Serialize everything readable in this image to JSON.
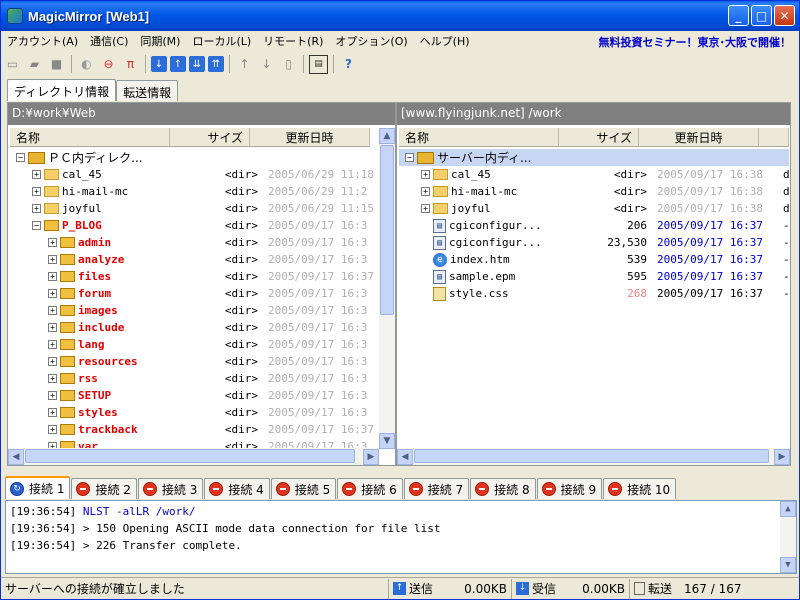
{
  "window": {
    "title": "MagicMirror [Web1]"
  },
  "menu": {
    "items": [
      "アカウント(A)",
      "通信(C)",
      "同期(M)",
      "ローカル(L)",
      "リモート(R)",
      "オプション(O)",
      "ヘルプ(H)"
    ],
    "promo": "無料投資セミナー！東京･大阪で開催！"
  },
  "toolbar": {
    "icons": [
      "new-icon",
      "open-icon",
      "save-icon",
      "connect-icon",
      "disconnect-icon",
      "filter-icon",
      "upload-icon",
      "upload-all-icon",
      "download-icon",
      "download-all-icon",
      "up-folder-icon",
      "down-folder-icon",
      "file-icon",
      "terminal-icon",
      "help-icon"
    ]
  },
  "tabs_top": [
    "ディレクトリ情報",
    "転送情報"
  ],
  "local": {
    "path": "D:¥work¥Web",
    "columns": [
      "名称",
      "サイズ",
      "更新日時"
    ],
    "rows": [
      {
        "name": "ＰＣ内ディレク...",
        "size": "",
        "date": "",
        "level": 0,
        "type": "root"
      },
      {
        "name": "cal_45",
        "size": "<dir>",
        "date": "2005/06/29 11:18",
        "level": 1,
        "type": "folder"
      },
      {
        "name": "hi-mail-mc",
        "size": "<dir>",
        "date": "2005/06/29 11:2",
        "level": 1,
        "type": "folder"
      },
      {
        "name": "joyful",
        "size": "<dir>",
        "date": "2005/06/29 11:15",
        "level": 1,
        "type": "folder"
      },
      {
        "name": "P_BLOG",
        "size": "<dir>",
        "date": "2005/09/17 16:3",
        "level": 1,
        "type": "folder-red"
      },
      {
        "name": "admin",
        "size": "<dir>",
        "date": "2005/09/17 16:3",
        "level": 2,
        "type": "folder-red"
      },
      {
        "name": "analyze",
        "size": "<dir>",
        "date": "2005/09/17 16:3",
        "level": 2,
        "type": "folder-red"
      },
      {
        "name": "files",
        "size": "<dir>",
        "date": "2005/09/17 16:37",
        "level": 2,
        "type": "folder-red"
      },
      {
        "name": "forum",
        "size": "<dir>",
        "date": "2005/09/17 16:3",
        "level": 2,
        "type": "folder-red"
      },
      {
        "name": "images",
        "size": "<dir>",
        "date": "2005/09/17 16:3",
        "level": 2,
        "type": "folder-red"
      },
      {
        "name": "include",
        "size": "<dir>",
        "date": "2005/09/17 16:3",
        "level": 2,
        "type": "folder-red"
      },
      {
        "name": "lang",
        "size": "<dir>",
        "date": "2005/09/17 16:3",
        "level": 2,
        "type": "folder-red"
      },
      {
        "name": "resources",
        "size": "<dir>",
        "date": "2005/09/17 16:3",
        "level": 2,
        "type": "folder-red"
      },
      {
        "name": "rss",
        "size": "<dir>",
        "date": "2005/09/17 16:3",
        "level": 2,
        "type": "folder-red"
      },
      {
        "name": "SETUP",
        "size": "<dir>",
        "date": "2005/09/17 16:3",
        "level": 2,
        "type": "folder-red"
      },
      {
        "name": "styles",
        "size": "<dir>",
        "date": "2005/09/17 16:3",
        "level": 2,
        "type": "folder-red"
      },
      {
        "name": "trackback",
        "size": "<dir>",
        "date": "2005/09/17 16:37",
        "level": 2,
        "type": "folder-red"
      },
      {
        "name": "var",
        "size": "<dir>",
        "date": "2005/09/17 16:3",
        "level": 2,
        "type": "folder-red"
      }
    ]
  },
  "remote": {
    "path": "[www.flyingjunk.net] /work",
    "columns": [
      "名称",
      "サイズ",
      "更新日時"
    ],
    "rows": [
      {
        "name": "サーバー内ディ...",
        "size": "",
        "date": "",
        "attr": "",
        "level": 0,
        "type": "root"
      },
      {
        "name": "cal_45",
        "size": "<dir>",
        "date": "2005/09/17 16:38",
        "attr": "d",
        "level": 1,
        "type": "folder",
        "date_color": "gray"
      },
      {
        "name": "hi-mail-mc",
        "size": "<dir>",
        "date": "2005/09/17 16:38",
        "attr": "d",
        "level": 1,
        "type": "folder",
        "date_color": "gray"
      },
      {
        "name": "joyful",
        "size": "<dir>",
        "date": "2005/09/17 16:38",
        "attr": "d",
        "level": 1,
        "type": "folder",
        "date_color": "gray"
      },
      {
        "name": "cgiconfigur...",
        "size": "206",
        "date": "2005/09/17 16:37",
        "attr": "-",
        "level": 1,
        "type": "file",
        "date_color": "blue"
      },
      {
        "name": "cgiconfigur...",
        "size": "23,530",
        "date": "2005/09/17 16:37",
        "attr": "-",
        "level": 1,
        "type": "file",
        "date_color": "blue"
      },
      {
        "name": "index.htm",
        "size": "539",
        "date": "2005/09/17 16:37",
        "attr": "-",
        "level": 1,
        "type": "ie",
        "date_color": "blue"
      },
      {
        "name": "sample.epm",
        "size": "595",
        "date": "2005/09/17 16:37",
        "attr": "-",
        "level": 1,
        "type": "file",
        "date_color": "blue"
      },
      {
        "name": "style.css",
        "size": "268",
        "date": "2005/09/17 16:37",
        "attr": "-",
        "level": 1,
        "type": "css",
        "date_color": "black",
        "size_color": "red"
      }
    ]
  },
  "connections": [
    "接続 1",
    "接続 2",
    "接続 3",
    "接続 4",
    "接続 5",
    "接続 6",
    "接続 7",
    "接続 8",
    "接続 9",
    "接続 10"
  ],
  "log": [
    {
      "time": "[19:36:54]",
      "text": "NLST -alLR /work/",
      "cmd": true
    },
    {
      "time": "[19:36:54]",
      "text": ">  150 Opening ASCII mode data connection for file list",
      "cmd": false
    },
    {
      "time": "[19:36:54]",
      "text": ">  226 Transfer complete.",
      "cmd": false
    }
  ],
  "status": {
    "message": "サーバーへの接続が確立しました",
    "send_label": "送信",
    "send_value": "0.00KB",
    "recv_label": "受信",
    "recv_value": "0.00KB",
    "transfer_label": "転送",
    "transfer_value": "167 /   167"
  },
  "colors": {
    "folder_red": "#e00000",
    "date_gray": "#b0b0b0",
    "date_blue": "#0000cc",
    "promo": "#0000cc"
  }
}
